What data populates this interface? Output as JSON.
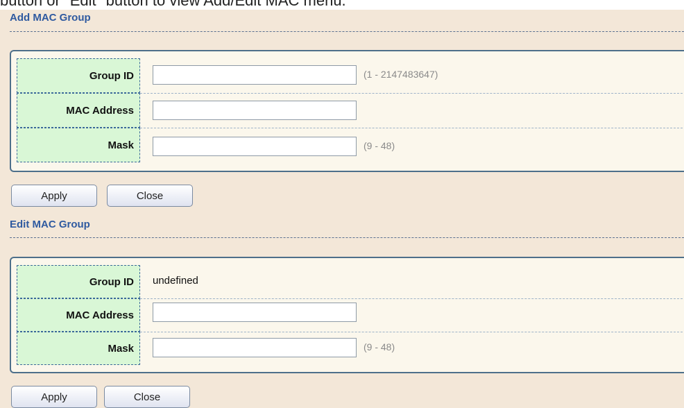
{
  "caption": "button or \"Edit\" button to view Add/Edit MAC menu.",
  "add": {
    "title": "Add MAC Group",
    "fields": {
      "group_id": {
        "label": "Group ID",
        "value": "",
        "hint": "(1 - 2147483647)"
      },
      "mac_address": {
        "label": "MAC Address",
        "value": ""
      },
      "mask": {
        "label": "Mask",
        "value": "",
        "hint": "(9 - 48)"
      }
    },
    "apply_label": "Apply",
    "close_label": "Close"
  },
  "edit": {
    "title": "Edit MAC Group",
    "fields": {
      "group_id": {
        "label": "Group ID",
        "value": "undefined"
      },
      "mac_address": {
        "label": "MAC Address",
        "value": ""
      },
      "mask": {
        "label": "Mask",
        "value": "",
        "hint": "(9 - 48)"
      }
    },
    "apply_label": "Apply",
    "close_label": "Close"
  }
}
